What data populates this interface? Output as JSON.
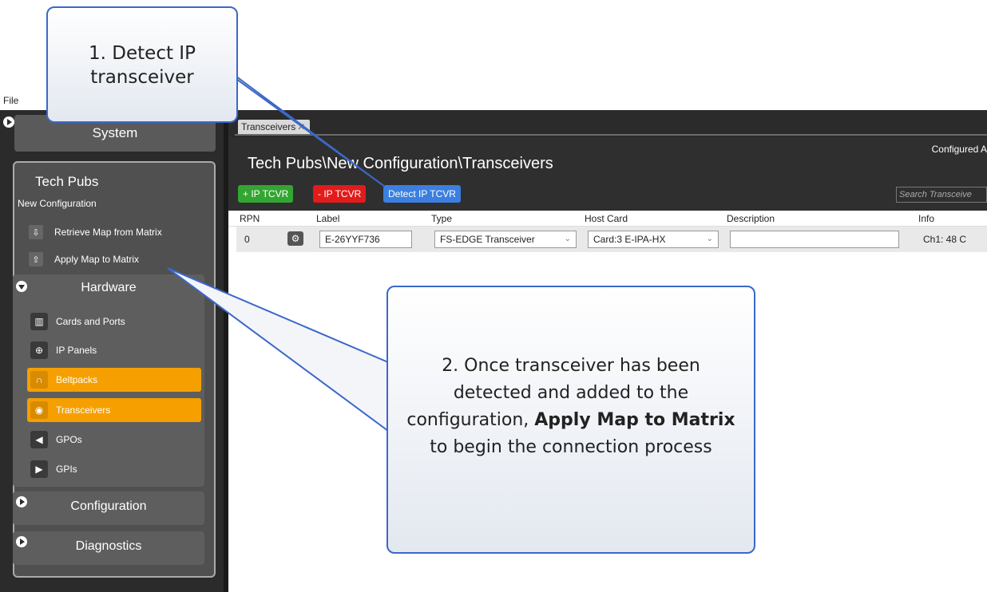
{
  "menu": {
    "file": "File"
  },
  "sidebar": {
    "system": "System",
    "project_name": "Tech Pubs",
    "config_name": "New Configuration",
    "actions": [
      {
        "label": "Retrieve Map from Matrix",
        "icon": "retrieve-map-icon"
      },
      {
        "label": "Apply Map to Matrix",
        "icon": "apply-map-icon"
      }
    ],
    "hardware": {
      "title": "Hardware",
      "items": [
        {
          "label": "Cards and Ports",
          "icon": "cards-ports-icon",
          "active": false
        },
        {
          "label": "IP Panels",
          "icon": "ip-panels-icon",
          "active": false
        },
        {
          "label": "Beltpacks",
          "icon": "beltpack-icon",
          "active": true
        },
        {
          "label": "Transceivers",
          "icon": "transceiver-icon",
          "active": true
        },
        {
          "label": "GPOs",
          "icon": "gpo-icon",
          "active": false
        },
        {
          "label": "GPIs",
          "icon": "gpi-icon",
          "active": false
        }
      ]
    },
    "configuration": "Configuration",
    "diagnostics": "Diagnostics"
  },
  "main": {
    "tab": "Transceivers",
    "tab_close": "✕",
    "breadcrumb": "Tech Pubs\\New Configuration\\Transceivers",
    "configured": "Configured A",
    "buttons": {
      "add": "+ IP TCVR",
      "remove": "- IP TCVR",
      "detect": "Detect IP TCVR"
    },
    "search_placeholder": "Search Transceive",
    "columns": [
      "RPN",
      "Label",
      "Type",
      "Host Card",
      "Description",
      "Info"
    ],
    "rows": [
      {
        "rpn": "0",
        "label": "E-26YYF736",
        "type": "FS-EDGE Transceiver",
        "host_card": "Card:3 E-IPA-HX",
        "description": "",
        "info": "Ch1: 48  C"
      }
    ]
  },
  "callouts": {
    "step1": "1. Detect IP transceiver",
    "step2_pre": "2. Once transceiver has been detected and added to the configuration, ",
    "step2_bold": "Apply Map to Matrix",
    "step2_post": " to begin the connection process"
  },
  "colors": {
    "green": "#33a532",
    "red": "#e21b1b",
    "blue": "#3b7fe0",
    "orange": "#f5a000",
    "callout_border": "#3b68c9"
  }
}
